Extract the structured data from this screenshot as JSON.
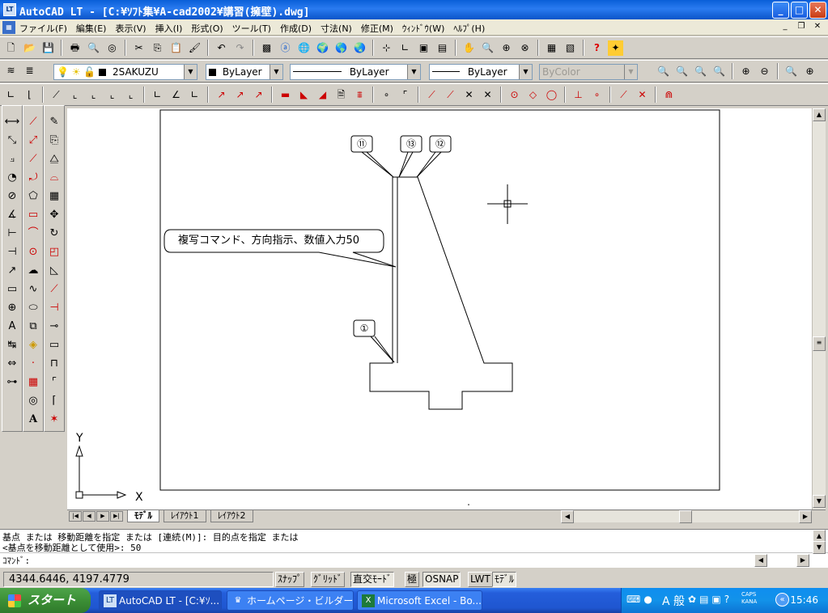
{
  "window": {
    "title": "AutoCAD LT - [C:¥ｿﾌﾄ集¥A-cad2002¥講習(擁壁).dwg]",
    "app_icon": "LT",
    "minimize": "_",
    "maximize": "□",
    "close": "✕"
  },
  "menu": {
    "items": [
      "ファイル(F)",
      "編集(E)",
      "表示(V)",
      "挿入(I)",
      "形式(O)",
      "ツール(T)",
      "作成(D)",
      "寸法(N)",
      "修正(M)",
      "ｳｨﾝﾄﾞｳ(W)",
      "ﾍﾙﾌﾟ(H)"
    ],
    "mdi_minimize": "_",
    "mdi_restore": "❐",
    "mdi_close": "✕"
  },
  "properties": {
    "layer": "2SAKUZU",
    "color": "ByLayer",
    "linetype": "ByLayer",
    "lineweight": "ByLayer",
    "plotstyle": "ByColor"
  },
  "drawing": {
    "callout_text": "複写コマンド、方向指示、数値入力50",
    "labels": {
      "top_left": "⑪",
      "top_mid": "⑬",
      "top_right": "⑫",
      "lower": "①"
    },
    "ucs_x": "X",
    "ucs_y": "Y"
  },
  "tabs": [
    "ﾓﾃﾞﾙ",
    "ﾚｲｱｳﾄ1",
    "ﾚｲｱｳﾄ2"
  ],
  "command": {
    "history_1": "基点 または 移動距離を指定 または [連続(M)]: 目的点を指定 または",
    "history_2": "<基点を移動距離として使用>: 50",
    "prompt": "ｺﾏﾝﾄﾞ:"
  },
  "status": {
    "coordinates": "4344.6446,  4197.4779",
    "snap": "ｽﾅｯﾌﾟ",
    "grid": "ｸﾞﾘｯﾄﾞ",
    "ortho": "直交ﾓｰﾄﾞ",
    "polar": "極",
    "osnap": "OSNAP",
    "lwt": "LWT",
    "model": "ﾓﾃﾞﾙ"
  },
  "taskbar": {
    "start": "スタート",
    "tasks": [
      {
        "label": "AutoCAD LT - [C:¥ｿ...",
        "icon": "autocad-icon"
      },
      {
        "label": "ホームページ・ビルダー ...",
        "icon": "homepage-builder-icon"
      },
      {
        "label": "Microsoft Excel - Bo...",
        "icon": "excel-icon"
      }
    ],
    "ime": "A 般",
    "caps": "CAPS",
    "kana": "KANA",
    "clock": "15:46"
  }
}
